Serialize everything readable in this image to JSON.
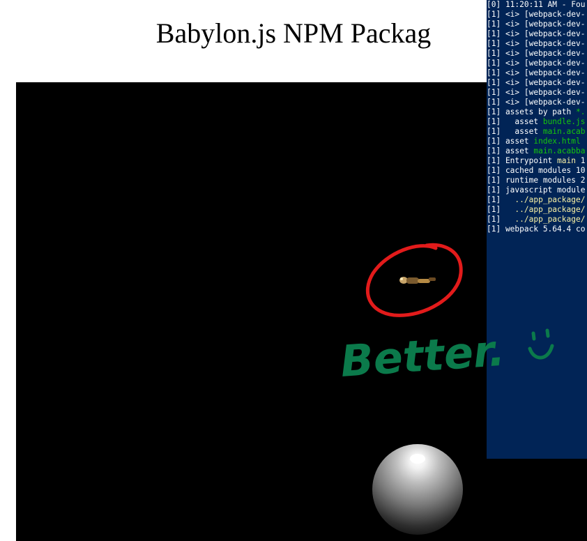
{
  "page": {
    "title": "Babylon.js NPM Packag"
  },
  "annotation": {
    "text": "Better.",
    "emoji": "smiley-face-icon",
    "circle_color": "#e21b1b",
    "text_color": "#0b7a4b"
  },
  "terminal": {
    "background": "#012456",
    "lines": [
      {
        "prefix": "[0] 11:20:11 AM - Fou",
        "highlight": "",
        "suffix": ""
      },
      {
        "prefix": "[1] <i> [webpack-dev-",
        "highlight": "",
        "suffix": ""
      },
      {
        "prefix": "[1] <i> [webpack-dev-",
        "highlight": "",
        "suffix": ""
      },
      {
        "prefix": "[1] <i> [webpack-dev-",
        "highlight": "",
        "suffix": ""
      },
      {
        "prefix": "[1] <i> [webpack-dev-",
        "highlight": "",
        "suffix": ""
      },
      {
        "prefix": "[1] <i> [webpack-dev-",
        "highlight": "",
        "suffix": ""
      },
      {
        "prefix": "[1] <i> [webpack-dev-",
        "highlight": "",
        "suffix": ""
      },
      {
        "prefix": "[1] <i> [webpack-dev-",
        "highlight": "",
        "suffix": ""
      },
      {
        "prefix": "[1] <i> [webpack-dev-",
        "highlight": "",
        "suffix": ""
      },
      {
        "prefix": "[1] <i> [webpack-dev-",
        "highlight": "",
        "suffix": ""
      },
      {
        "prefix": "[1] <i> [webpack-dev-",
        "highlight": "",
        "suffix": ""
      },
      {
        "prefix": "[1] assets by path ",
        "highlight": "*.",
        "suffix": "",
        "hl_color": "green"
      },
      {
        "prefix": "[1]   asset ",
        "highlight": "bundle.js",
        "suffix": "",
        "hl_color": "green"
      },
      {
        "prefix": "[1]   asset ",
        "highlight": "main.acab",
        "suffix": "",
        "hl_color": "green"
      },
      {
        "prefix": "[1] asset ",
        "highlight": "index.html",
        "suffix": "",
        "hl_color": "green"
      },
      {
        "prefix": "[1] asset ",
        "highlight": "main.acabba",
        "suffix": "",
        "hl_color": "green"
      },
      {
        "prefix": "[1] Entrypoint ",
        "highlight": "main",
        "suffix": " 1",
        "hl_color": "yellow"
      },
      {
        "prefix": "[1] cached modules 10",
        "highlight": "",
        "suffix": ""
      },
      {
        "prefix": "[1] runtime modules 2",
        "highlight": "",
        "suffix": ""
      },
      {
        "prefix": "[1] javascript module",
        "highlight": "",
        "suffix": ""
      },
      {
        "prefix": "[1]   ",
        "highlight": "../app_package/",
        "suffix": "",
        "hl_color": "yellow"
      },
      {
        "prefix": "[1]   ",
        "highlight": "../app_package/",
        "suffix": "",
        "hl_color": "yellow"
      },
      {
        "prefix": "[1]   ",
        "highlight": "../app_package/",
        "suffix": "",
        "hl_color": "yellow"
      },
      {
        "prefix": "[1] webpack 5.64.4 co",
        "highlight": "",
        "suffix": ""
      }
    ]
  }
}
